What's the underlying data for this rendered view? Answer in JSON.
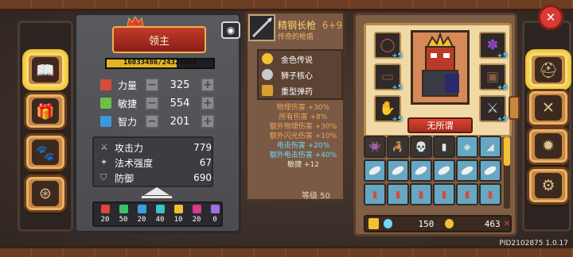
{
  "hero": {
    "title": "领主",
    "exp_text": "16033486/24324500",
    "exp_progress": 0.659,
    "name": "无所谓"
  },
  "stats": [
    {
      "name": "力量",
      "value": "325",
      "color": "#d64b3a"
    },
    {
      "name": "敏捷",
      "value": "554",
      "color": "#6cc04a"
    },
    {
      "name": "智力",
      "value": "201",
      "color": "#3a9ad9"
    }
  ],
  "combat": [
    {
      "name": "攻击力",
      "value": "779",
      "icon": "sword-icon"
    },
    {
      "name": "法术强度",
      "value": "67",
      "icon": "wand-icon"
    },
    {
      "name": "防御",
      "value": "690",
      "icon": "shield-icon"
    }
  ],
  "resources": [
    {
      "value": "20",
      "color": "#e2453a"
    },
    {
      "value": "50",
      "color": "#3cc26a"
    },
    {
      "value": "20",
      "color": "#3aa0e0"
    },
    {
      "value": "40",
      "color": "#3cc2c2"
    },
    {
      "value": "10",
      "color": "#f0c030"
    },
    {
      "value": "20",
      "color": "#d93a8a"
    },
    {
      "value": "0",
      "color": "#a070e0"
    }
  ],
  "weapon": {
    "name": "精钢长枪",
    "enhance": "6+9",
    "subtitle": "传奇的枪盾",
    "abilities": [
      {
        "name": "金色传说",
        "color": "#f2c032"
      },
      {
        "name": "狮子核心",
        "color": "#c9c9c9"
      },
      {
        "name": "重型弹药",
        "color": "#d9a030"
      }
    ],
    "bonuses": [
      {
        "text": "物理伤害 +30%",
        "color": "#f2a45a"
      },
      {
        "text": "所有伤害 +8%",
        "color": "#f2a45a"
      },
      {
        "text": "额外物理伤害 +30%",
        "color": "#f2a45a"
      },
      {
        "text": "额外闪光伤害 +10%",
        "color": "#f2a45a"
      },
      {
        "text": "电击伤害 +20%",
        "color": "#6cd9ff"
      },
      {
        "text": "额外电击伤害 +40%",
        "color": "#6cd9ff"
      },
      {
        "text": "敏捷 +12",
        "color": "#f0e6c8"
      }
    ],
    "level_text": "等级 50"
  },
  "equipment": {
    "slots": [
      {
        "name": "ring-slot",
        "plus": "+5",
        "glyph": "◯",
        "color": "#d64b3a"
      },
      {
        "name": "belt-slot",
        "plus": "+5",
        "glyph": "▭",
        "color": "#8a5a3a"
      },
      {
        "name": "gauntlet-slot",
        "plus": "+5",
        "glyph": "✋",
        "color": "#b8b8b8"
      },
      {
        "name": "cloak-slot",
        "plus": "+5",
        "glyph": "✽",
        "color": "#9a4ad0"
      },
      {
        "name": "armor-slot",
        "plus": "+6",
        "glyph": "▣",
        "color": "#6a3c1c"
      },
      {
        "name": "weapon-slot",
        "plus": "+9",
        "glyph": "⚔",
        "color": "#c9c9c9"
      }
    ],
    "gems": "150",
    "coins": "463"
  },
  "side_menu": [
    "book-icon",
    "gift-icon",
    "paw-icon",
    "wheel-icon"
  ],
  "right_menu": [
    "helmet-icon",
    "crossed-tools-icon",
    "compass-icon",
    "gear-icon"
  ],
  "version": "PID2102875 1.0.17"
}
